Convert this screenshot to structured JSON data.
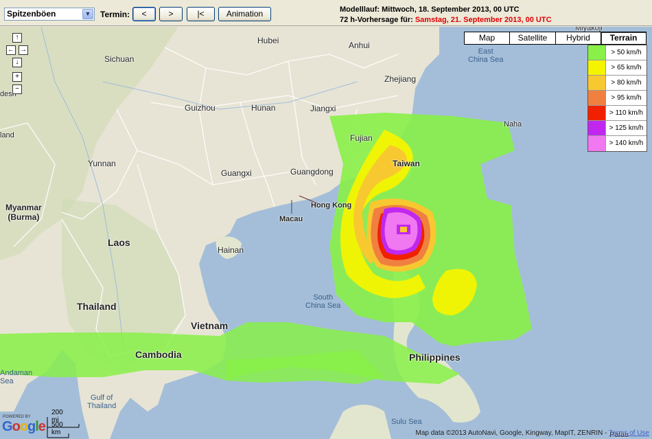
{
  "toolbar": {
    "product_value": "Spitzenböen",
    "termin_label": "Termin:",
    "back_label": "<",
    "forward_label": ">",
    "first_label": "|<",
    "animation_label": "Animation",
    "model_run": "Modelllauf: Mittwoch, 18. September 2013, 00 UTC",
    "forecast_prefix": "72 h-Vorhersage für: ",
    "forecast_date": "Samstag, 21. September 2013, 00 UTC"
  },
  "map_types": [
    "Map",
    "Satellite",
    "Hybrid",
    "Terrain"
  ],
  "map_type_active": "Terrain",
  "legend": [
    {
      "label": "> 50 km/h",
      "color": "#88f048"
    },
    {
      "label": "> 65 km/h",
      "color": "#f4f400"
    },
    {
      "label": "> 80 km/h",
      "color": "#f8c830"
    },
    {
      "label": "> 95 km/h",
      "color": "#f08040"
    },
    {
      "label": "> 110 km/h",
      "color": "#f02000"
    },
    {
      "label": "> 125 km/h",
      "color": "#c028f0"
    },
    {
      "label": "> 140 km/h",
      "color": "#f078f0"
    }
  ],
  "places": {
    "hubei": "Hubei",
    "anhui": "Anhui",
    "sichuan": "Sichuan",
    "zhejiang": "Zhejiang",
    "guizhou": "Guizhou",
    "hunan": "Hunan",
    "jiangxi": "Jiangxi",
    "fujian": "Fujian",
    "yunnan": "Yunnan",
    "guangxi": "Guangxi",
    "guangdong": "Guangdong",
    "taiwan": "Taiwan",
    "hongkong": "Hong Kong",
    "macau": "Macau",
    "myanmar": "Myanmar\n(Burma)",
    "laos": "Laos",
    "hainan": "Hainan",
    "thailand": "Thailand",
    "vietnam": "Vietnam",
    "cambodia": "Cambodia",
    "philippines": "Philippines",
    "east_china_sea": "East\nChina Sea",
    "south_china_sea": "South\nChina Sea",
    "naha": "Naha",
    "miyakoji": "Miyakoji",
    "andaman": "Andaman\nSea",
    "gulf_thailand": "Gulf of\nThailand",
    "sulu": "Sulu Sea",
    "palau": "Palau",
    "land": "land",
    "desh": "desh"
  },
  "attribution": "Map data ©2013 AutoNavi, Google, Kingway, MapIT, ZENRIN - ",
  "terms": "Terms of Use",
  "scale_mi": "200 mi",
  "scale_km": "500 km",
  "google": "Google",
  "powered": "POWERED BY"
}
